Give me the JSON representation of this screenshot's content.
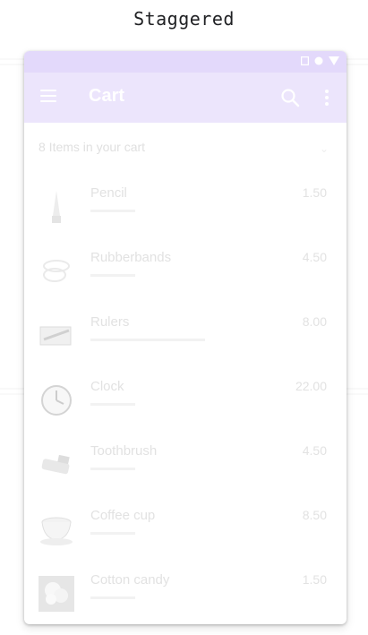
{
  "caption": "Staggered",
  "colors": {
    "status_bar": "#e3d9fb",
    "app_bar": "#ece5fc",
    "app_bar_text": "#ffffff",
    "faded_text": "#e2e2e2"
  },
  "status_icons": [
    "sim-icon",
    "circle-icon",
    "wifi-icon"
  ],
  "app_bar": {
    "title": "Cart",
    "icons": [
      "menu-icon",
      "search-icon",
      "more-vert-icon"
    ]
  },
  "cart": {
    "subheader": "8 Items in your cart",
    "items": [
      {
        "name": "Pencil",
        "price": "1.50",
        "icon": "pencil-icon"
      },
      {
        "name": "Rubberbands",
        "price": "4.50",
        "icon": "rubberbands-icon"
      },
      {
        "name": "Rulers",
        "price": "8.00",
        "icon": "rulers-icon"
      },
      {
        "name": "Clock",
        "price": "22.00",
        "icon": "clock-icon"
      },
      {
        "name": "Toothbrush",
        "price": "4.50",
        "icon": "toothbrush-icon"
      },
      {
        "name": "Coffee cup",
        "price": "8.50",
        "icon": "coffee-cup-icon"
      },
      {
        "name": "Cotton candy",
        "price": "1.50",
        "icon": "cotton-candy-icon"
      }
    ]
  }
}
